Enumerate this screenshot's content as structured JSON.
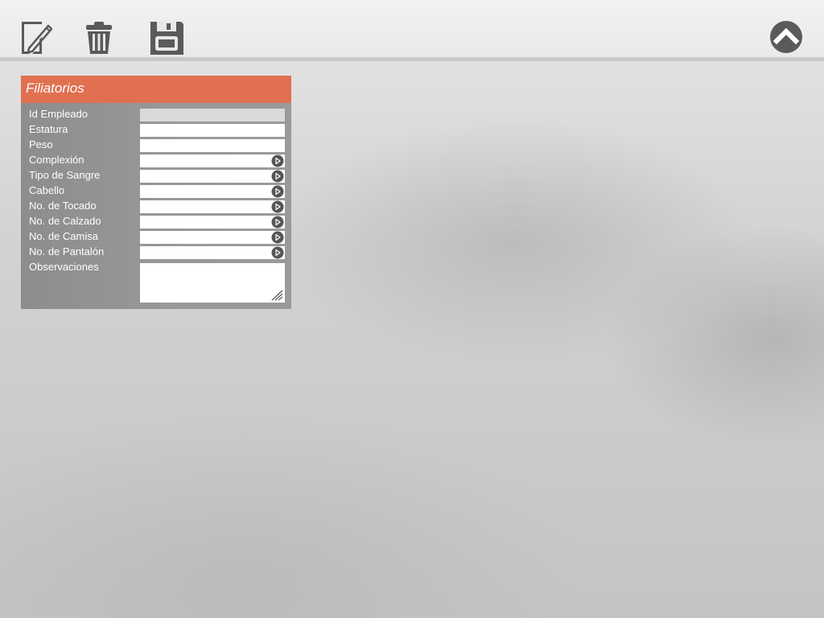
{
  "toolbar": {
    "icons": [
      "new-document-icon",
      "trash-icon",
      "save-icon",
      "chevron-up-icon"
    ]
  },
  "panel": {
    "title": "Filiatorios",
    "header_color": "#e07050",
    "fields": [
      {
        "label": "Id Empleado",
        "value": "",
        "type": "readonly"
      },
      {
        "label": "Estatura",
        "value": "",
        "type": "text"
      },
      {
        "label": "Peso",
        "value": "",
        "type": "text"
      },
      {
        "label": "Complexión",
        "value": "",
        "type": "select"
      },
      {
        "label": "Tipo de Sangre",
        "value": "",
        "type": "select"
      },
      {
        "label": "Cabello",
        "value": "",
        "type": "select"
      },
      {
        "label": "No. de Tocado",
        "value": "",
        "type": "select"
      },
      {
        "label": "No. de Calzado",
        "value": "",
        "type": "select"
      },
      {
        "label": "No. de Camisa",
        "value": "",
        "type": "select"
      },
      {
        "label": "No. de Pantalón",
        "value": "",
        "type": "select"
      }
    ],
    "notes": {
      "label": "Observaciones",
      "value": ""
    }
  }
}
